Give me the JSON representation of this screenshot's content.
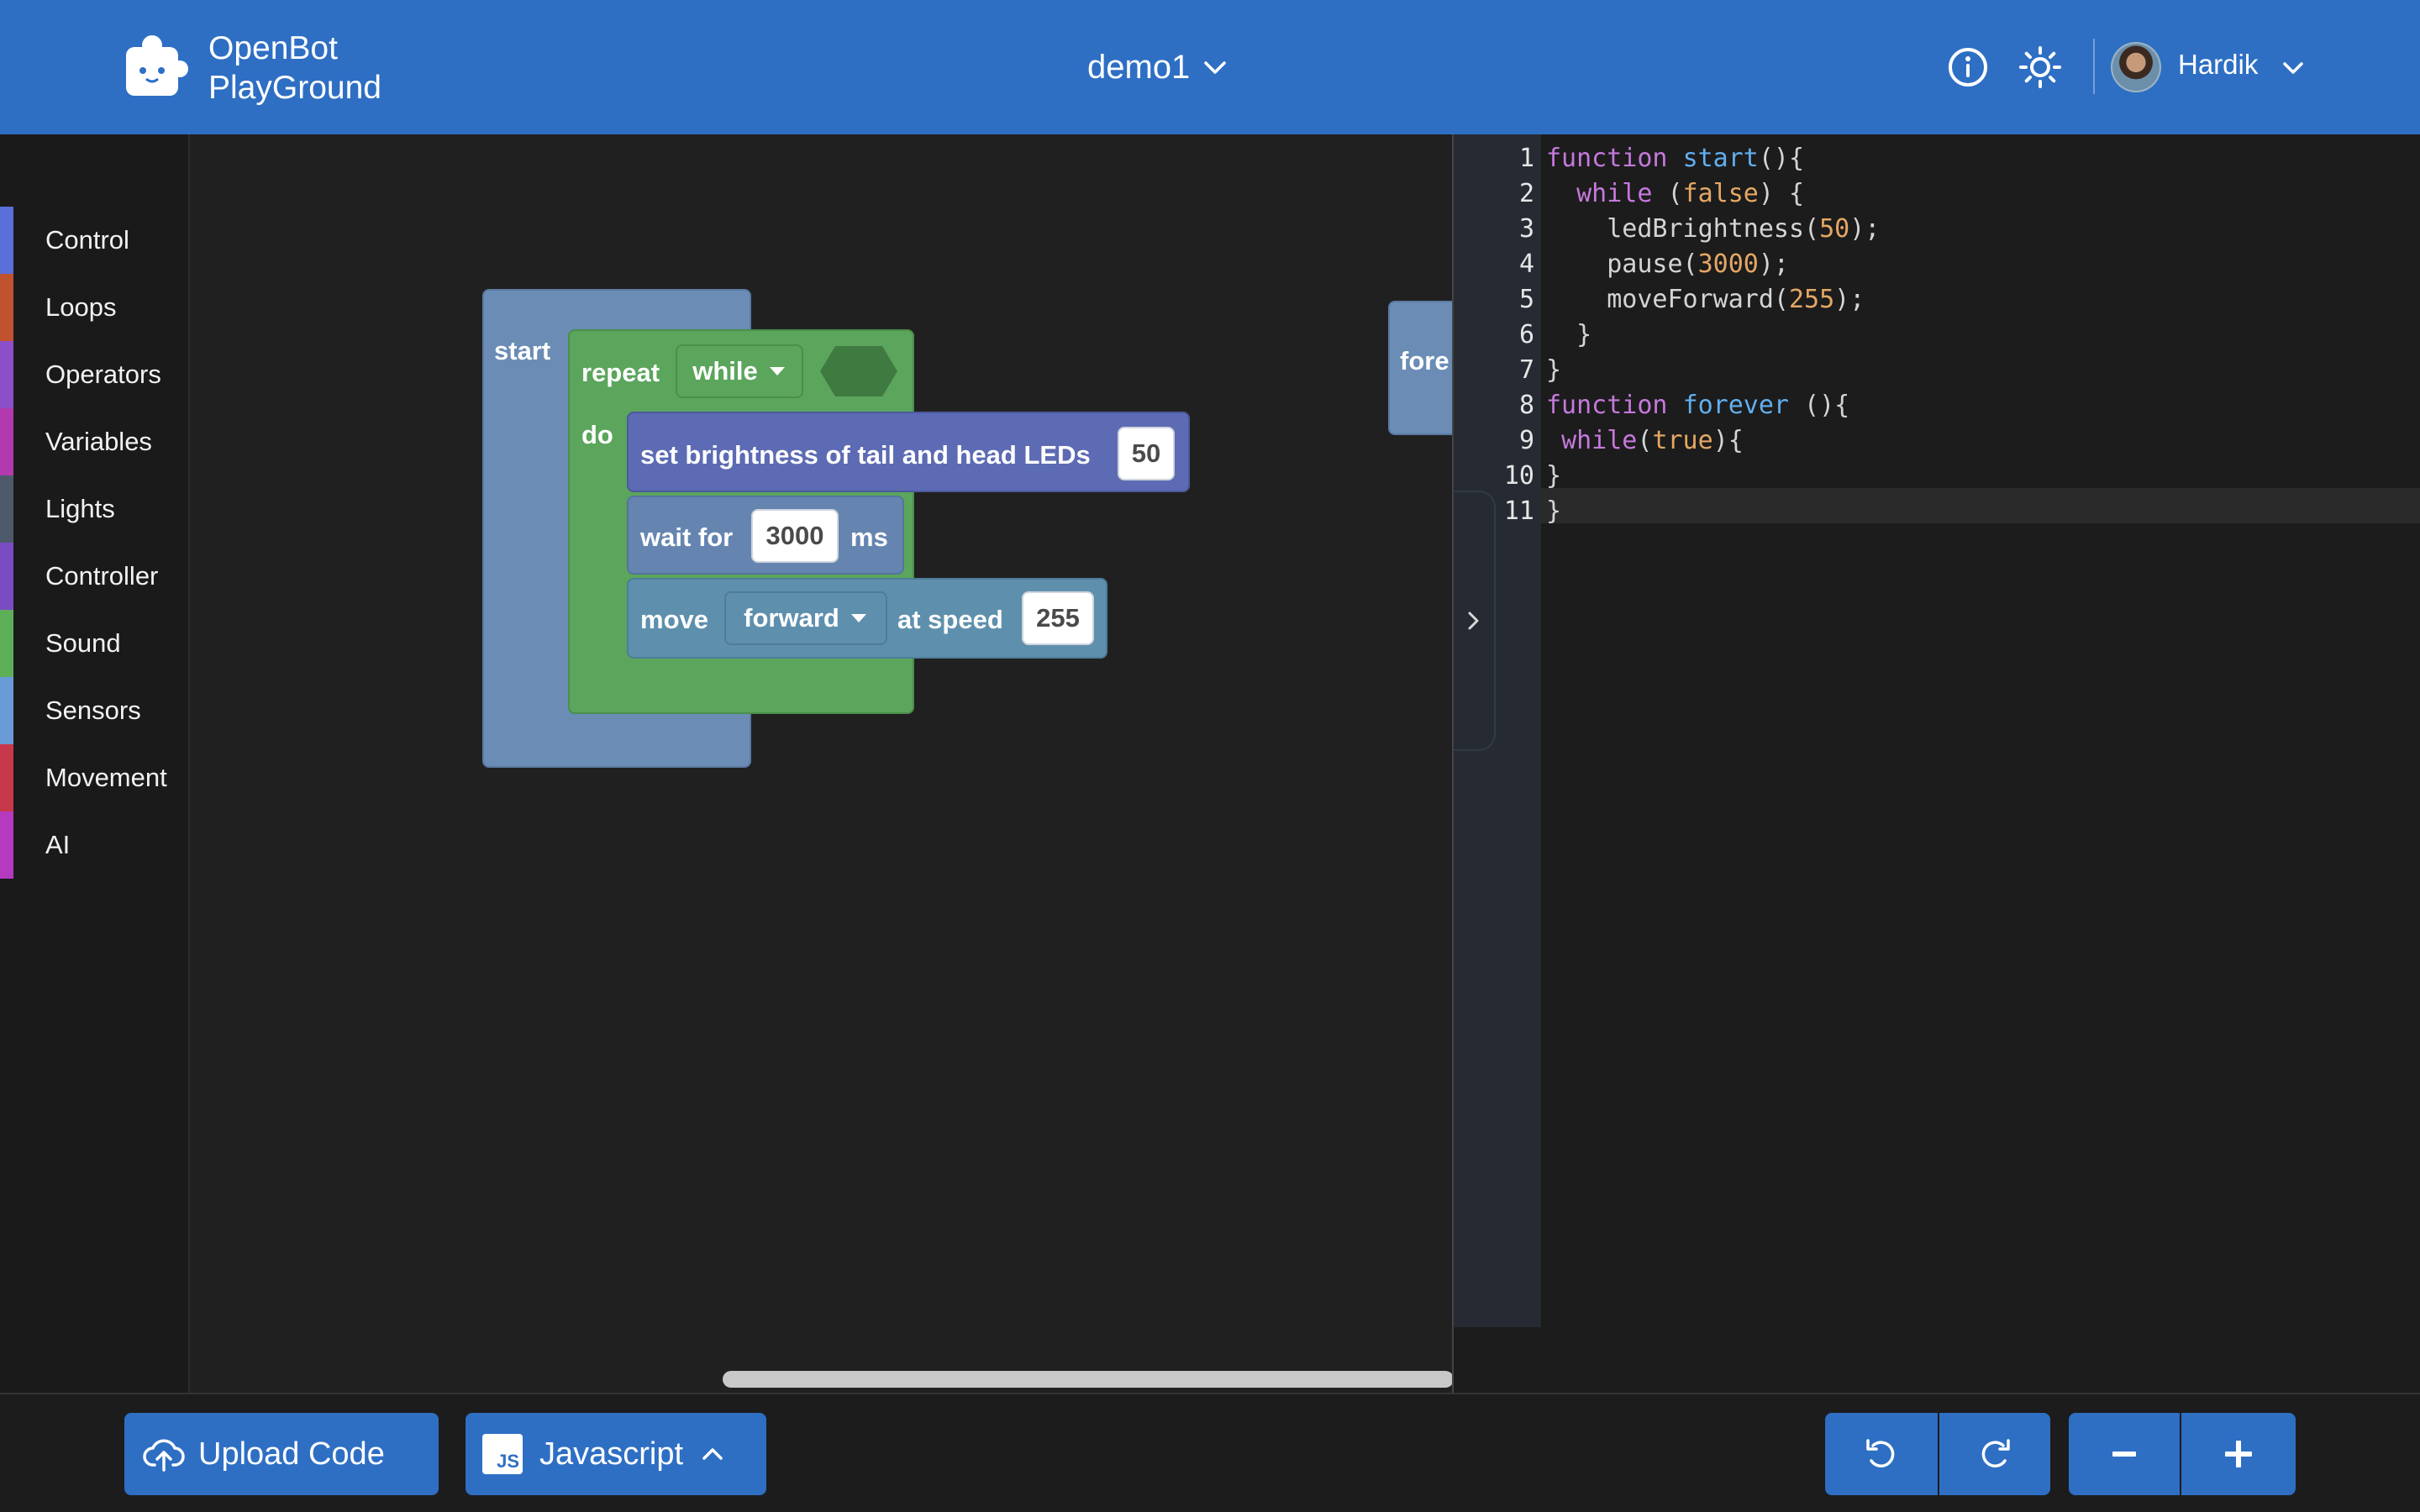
{
  "header": {
    "app_name_line1": "OpenBot",
    "app_name_line2": "PlayGround",
    "project_name": "demo1",
    "user_name": "Hardik"
  },
  "sidebar": {
    "categories": [
      {
        "label": "Control",
        "color": "#5a6fd8"
      },
      {
        "label": "Loops",
        "color": "#c0522f"
      },
      {
        "label": "Operators",
        "color": "#8a4fc9"
      },
      {
        "label": "Variables",
        "color": "#b23aae"
      },
      {
        "label": "Lights",
        "color": "#4d5a6b"
      },
      {
        "label": "Controller",
        "color": "#7b4bc4"
      },
      {
        "label": "Sound",
        "color": "#5cae57"
      },
      {
        "label": "Sensors",
        "color": "#6a9ad8"
      },
      {
        "label": "Movement",
        "color": "#c7384a"
      },
      {
        "label": "AI",
        "color": "#b53ac0"
      }
    ]
  },
  "workspace": {
    "start_block": {
      "label": "start"
    },
    "repeat_block": {
      "label": "repeat",
      "mode": "while",
      "do_label": "do"
    },
    "brightness_block": {
      "label": "set brightness of tail and head LEDs",
      "value": "50"
    },
    "wait_block": {
      "label": "wait for",
      "value": "3000",
      "unit": "ms"
    },
    "move_block": {
      "label": "move",
      "direction": "forward",
      "speed_label": "at speed",
      "speed": "255"
    },
    "forever_block": {
      "label": "fore"
    }
  },
  "code": {
    "lines": [
      {
        "n": "1",
        "tokens": [
          {
            "t": "function",
            "c": "kw"
          },
          {
            "t": " "
          },
          {
            "t": "start",
            "c": "fn"
          },
          {
            "t": "(){"
          }
        ]
      },
      {
        "n": "2",
        "tokens": [
          {
            "t": "  "
          },
          {
            "t": "while",
            "c": "kw"
          },
          {
            "t": " ("
          },
          {
            "t": "false",
            "c": "bool"
          },
          {
            "t": ") {"
          }
        ]
      },
      {
        "n": "3",
        "tokens": [
          {
            "t": "    ledBrightness("
          },
          {
            "t": "50",
            "c": "num"
          },
          {
            "t": ");"
          }
        ]
      },
      {
        "n": "4",
        "tokens": [
          {
            "t": "    pause("
          },
          {
            "t": "3000",
            "c": "num"
          },
          {
            "t": ");"
          }
        ]
      },
      {
        "n": "5",
        "tokens": [
          {
            "t": "    moveForward("
          },
          {
            "t": "255",
            "c": "num"
          },
          {
            "t": ");"
          }
        ]
      },
      {
        "n": "6",
        "tokens": [
          {
            "t": "  }"
          }
        ]
      },
      {
        "n": "7",
        "tokens": [
          {
            "t": "}"
          }
        ]
      },
      {
        "n": "8",
        "tokens": [
          {
            "t": "function",
            "c": "kw"
          },
          {
            "t": " "
          },
          {
            "t": "forever",
            "c": "fn"
          },
          {
            "t": " (){"
          }
        ]
      },
      {
        "n": "9",
        "tokens": [
          {
            "t": " "
          },
          {
            "t": "while",
            "c": "kw"
          },
          {
            "t": "("
          },
          {
            "t": "true",
            "c": "bool"
          },
          {
            "t": "){"
          }
        ]
      },
      {
        "n": "10",
        "tokens": [
          {
            "t": "}"
          }
        ]
      },
      {
        "n": "11",
        "tokens": [
          {
            "t": "}"
          }
        ]
      }
    ]
  },
  "footer": {
    "upload_label": "Upload Code",
    "language_label": "Javascript",
    "language_badge": "JS"
  }
}
